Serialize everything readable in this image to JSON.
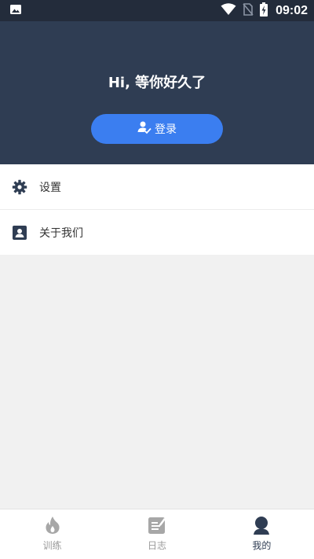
{
  "status_bar": {
    "time": "09:02",
    "icons": [
      "image-notification-icon",
      "wifi-icon",
      "no-sim-icon",
      "battery-charging-icon"
    ]
  },
  "header": {
    "greeting": "Hi, 等你好久了",
    "login_label": "登录",
    "login_icon": "user-check-icon",
    "background_color": "#2f3d53",
    "button_color": "#3b7ef0"
  },
  "menu": {
    "items": [
      {
        "label": "设置",
        "icon": "gear-icon"
      },
      {
        "label": "关于我们",
        "icon": "contact-card-icon"
      }
    ]
  },
  "tabs": [
    {
      "label": "训练",
      "icon": "flame-icon",
      "active": false
    },
    {
      "label": "日志",
      "icon": "notepad-edit-icon",
      "active": false
    },
    {
      "label": "我的",
      "icon": "person-icon",
      "active": true
    }
  ]
}
